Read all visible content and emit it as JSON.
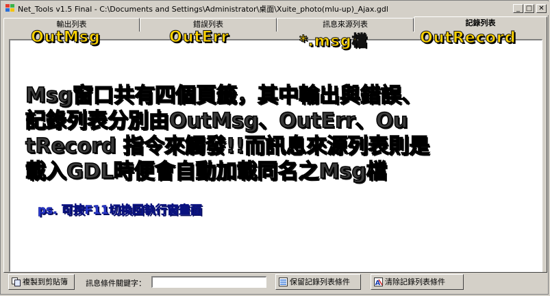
{
  "window": {
    "title": "Net_Tools v1.5 Final - C:\\Documents and Settings\\Administrator\\桌面\\Xuite_photo(mlu-up)_Ajax.gdl",
    "controls": {
      "minimize": "_",
      "maximize": "□",
      "close": "✕"
    }
  },
  "tabs": [
    {
      "label": "輸出列表",
      "overlay": "OutMsg",
      "active": false
    },
    {
      "label": "錯誤列表",
      "overlay": "OutErr",
      "active": false
    },
    {
      "label": "訊息來源列表",
      "overlay": "*.msg檔",
      "active": false
    },
    {
      "label": "記錄列表",
      "overlay": "OutRecord",
      "active": true
    }
  ],
  "content": {
    "main_message": "Msg窗口共有四個頁籤，其中輸出與錯誤、\n記錄列表分別由OutMsg、OutErr、Ou\ntRecord 指令來觸發!!而訊息來源列表則是\n載入GDL時便會自動加載同名之Msg檔",
    "ps_message": "ps. 可按F11切換回執行窗畫面"
  },
  "bottom": {
    "copy_button": "複製到剪貼簿",
    "keyword_label": "訊息條件關鍵字：",
    "keyword_value": "",
    "keep_button": "保留記錄列表條件",
    "clear_button": "清除記錄列表條件"
  },
  "colors": {
    "overlay_text": "#ffd400",
    "ps_text": "#2a3ad0",
    "window_bg": "#d4d0c8"
  }
}
